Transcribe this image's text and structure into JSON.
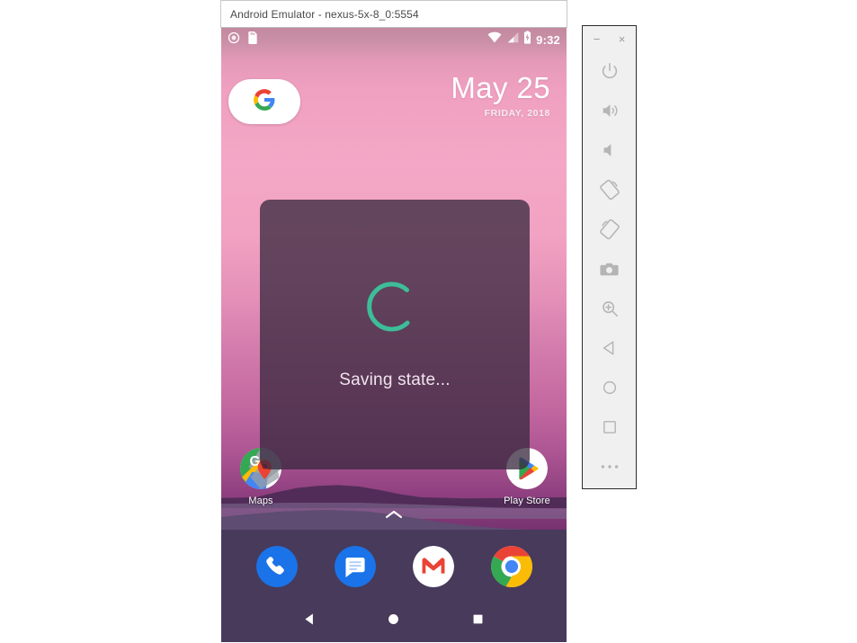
{
  "window": {
    "title": "Android Emulator - nexus-5x-8_0:5554"
  },
  "statusbar": {
    "left_icons": [
      {
        "name": "screen-record-icon"
      },
      {
        "name": "sd-card-icon"
      }
    ],
    "right_icons": [
      {
        "name": "wifi-icon"
      },
      {
        "name": "cellular-signal-icon"
      },
      {
        "name": "battery-charging-icon"
      }
    ],
    "clock": "9:32"
  },
  "homescreen": {
    "search_widget": {
      "name": "google-search-widget",
      "icon": "google-g-icon"
    },
    "date_widget": {
      "date": "May 25",
      "subtitle": "FRIDAY, 2018"
    },
    "apps": [
      {
        "label": "Maps",
        "icon": "google-maps-icon"
      },
      {
        "label": "Play Store",
        "icon": "google-play-store-icon"
      }
    ],
    "drawer_handle": {
      "name": "app-drawer-chevron",
      "icon": "chevron-up-icon"
    },
    "dock": [
      {
        "label": "Phone",
        "icon": "phone-icon"
      },
      {
        "label": "Messages",
        "icon": "messages-icon"
      },
      {
        "label": "Gmail",
        "icon": "gmail-icon"
      },
      {
        "label": "Chrome",
        "icon": "chrome-icon"
      }
    ],
    "navbar": [
      {
        "label": "Back",
        "icon": "back-triangle-icon"
      },
      {
        "label": "Home",
        "icon": "home-circle-icon"
      },
      {
        "label": "Recents",
        "icon": "recents-square-icon"
      }
    ]
  },
  "overlay": {
    "message": "Saving state...",
    "spinner": {
      "name": "loading-spinner",
      "color": "#3dbd98"
    }
  },
  "toolbar": {
    "window_buttons": [
      {
        "label": "−",
        "name": "minimize-button"
      },
      {
        "label": "×",
        "name": "close-button"
      }
    ],
    "items": [
      {
        "name": "power-button",
        "label": "Power"
      },
      {
        "name": "volume-up-button",
        "label": "Volume Up"
      },
      {
        "name": "volume-down-button",
        "label": "Volume Down"
      },
      {
        "name": "rotate-left-button",
        "label": "Rotate Left"
      },
      {
        "name": "rotate-right-button",
        "label": "Rotate Right"
      },
      {
        "name": "screenshot-button",
        "label": "Take Screenshot"
      },
      {
        "name": "zoom-button",
        "label": "Enter Zoom Mode"
      },
      {
        "name": "back-button",
        "label": "Back"
      },
      {
        "name": "home-button",
        "label": "Home"
      },
      {
        "name": "overview-button",
        "label": "Overview"
      },
      {
        "name": "more-button",
        "label": "More"
      }
    ]
  },
  "colors": {
    "spinner": "#3dbd98",
    "dock": "#473a5b",
    "overlay": "rgba(55,40,62,0.76)",
    "toolbar_bg": "#f0f0f0"
  }
}
